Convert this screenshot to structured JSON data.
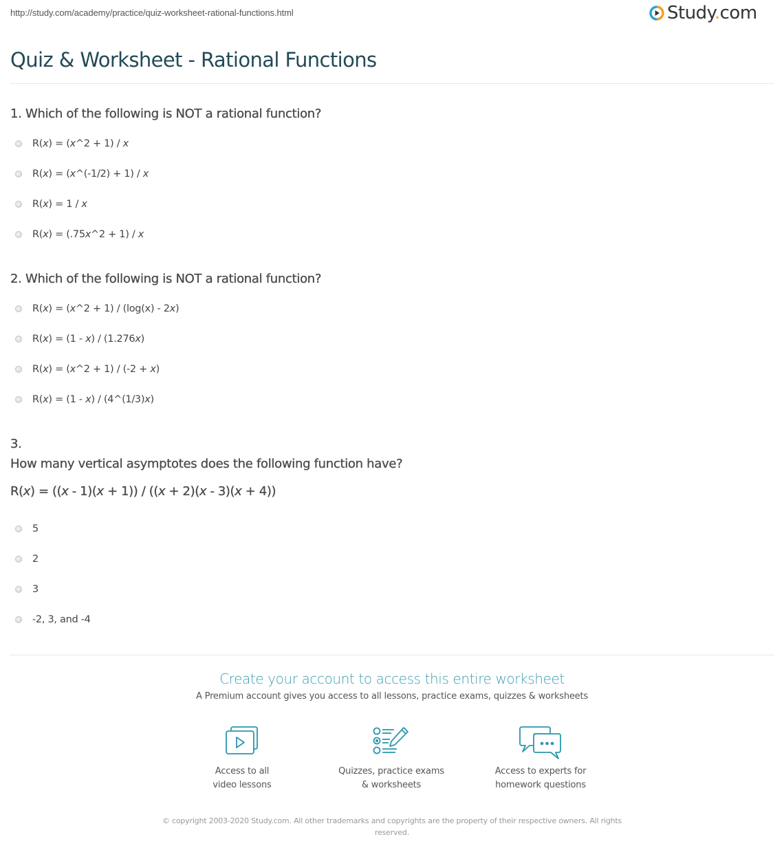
{
  "url": "http://study.com/academy/practice/quiz-worksheet-rational-functions.html",
  "logo": {
    "text_main": "Study",
    "text_dot": ".",
    "text_tld": "com",
    "icon": "play-circle-logo-icon",
    "colors": {
      "blue": "#2aa3cf",
      "orange": "#f39c27",
      "text": "#333333"
    }
  },
  "page_title": "Quiz & Worksheet - Rational Functions",
  "questions": [
    {
      "heading": "1. Which of the following is NOT a rational function?",
      "options": [
        "R(x) = (x^2 + 1) / x",
        "R(x) = (x^(-1/2) + 1) / x",
        "R(x) = 1 / x",
        "R(x) = (.75x^2 + 1) / x"
      ]
    },
    {
      "heading": "2. Which of the following is NOT a rational function?",
      "options": [
        "R(x) = (x^2 + 1) / (log(x) - 2x)",
        "R(x) = (1 - x) / (1.276x)",
        "R(x) = (x^2 + 1) / (-2 + x)",
        "R(x) = (1 - x) / (4^(1/3)x)"
      ]
    },
    {
      "number": "3.",
      "heading": "How many vertical asymptotes does the following function have?",
      "formula": "R(x) = ((x - 1)(x + 1)) / ((x + 2)(x - 3)(x + 4))",
      "options": [
        "5",
        "2",
        "3",
        "-2, 3, and -4"
      ]
    }
  ],
  "cta": {
    "title": "Create your account to access this entire worksheet",
    "subtitle": "A Premium account gives you access to all lessons, practice exams, quizzes & worksheets",
    "accent_color": "#3c9db0"
  },
  "features": [
    {
      "icon": "video-lessons-icon",
      "line1": "Access to all",
      "line2": "video lessons"
    },
    {
      "icon": "quiz-checklist-icon",
      "line1": "Quizzes, practice exams",
      "line2": "& worksheets"
    },
    {
      "icon": "chat-bubbles-icon",
      "line1": "Access to experts for",
      "line2": "homework questions"
    }
  ],
  "copyright": "© copyright 2003-2020 Study.com. All other trademarks and copyrights are the property of their respective owners. All rights reserved."
}
